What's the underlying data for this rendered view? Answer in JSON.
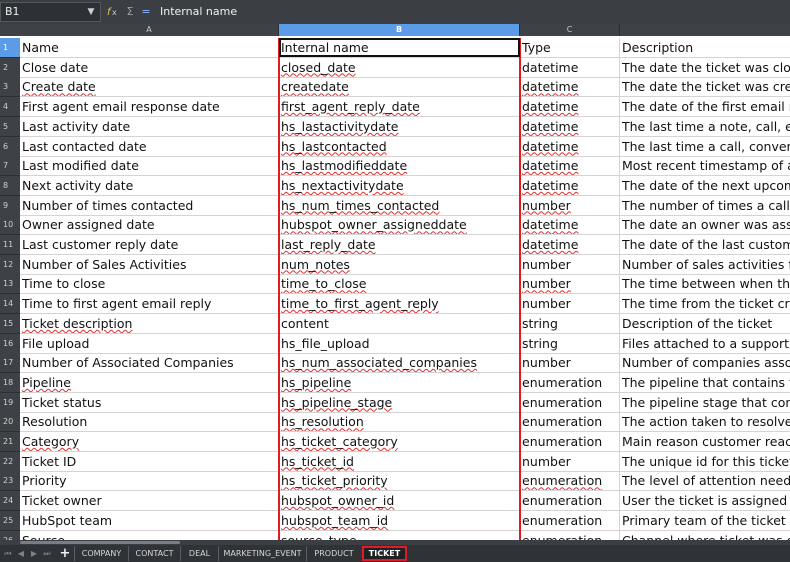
{
  "formula_bar": {
    "cell_ref": "B1",
    "content": "Internal name",
    "icons": [
      "function-wizard-icon",
      "sum-icon",
      "equals-icon"
    ]
  },
  "columns": [
    "A",
    "B",
    "C"
  ],
  "selected_column": "B",
  "rows": [
    {
      "n": "1",
      "name": "Name",
      "internal": "Internal name",
      "type": "Type",
      "desc": "Description"
    },
    {
      "n": "2",
      "name": "Close date",
      "internal": "closed_date",
      "type": "datetime",
      "desc": "The date the ticket was closed"
    },
    {
      "n": "3",
      "name": "Create date",
      "internal": "createdate",
      "type": "datetime",
      "desc": "The date the ticket was created"
    },
    {
      "n": "4",
      "name": "First agent email response date",
      "internal": "first_agent_reply_date",
      "type": "datetime",
      "desc": "The date of the first email res"
    },
    {
      "n": "5",
      "name": "Last activity date",
      "internal": "hs_lastactivitydate",
      "type": "datetime",
      "desc": "The last time a note, call, em"
    },
    {
      "n": "6",
      "name": "Last contacted date",
      "internal": "hs_lastcontacted",
      "type": "datetime",
      "desc": "The last time a call, conversa"
    },
    {
      "n": "7",
      "name": "Last modified date",
      "internal": "hs_lastmodifieddate",
      "type": "datetime",
      "desc": "Most recent timestamp of an"
    },
    {
      "n": "8",
      "name": "Next activity date",
      "internal": "hs_nextactivitydate",
      "type": "datetime",
      "desc": "The date of the next upcomin"
    },
    {
      "n": "9",
      "name": "Number of times contacted",
      "internal": "hs_num_times_contacted",
      "type": "number",
      "desc": "The number of times a call, e"
    },
    {
      "n": "10",
      "name": "Owner assigned date",
      "internal": "hubspot_owner_assigneddate",
      "type": "datetime",
      "desc": "The date an owner was assig"
    },
    {
      "n": "11",
      "name": "Last customer reply date",
      "internal": "last_reply_date",
      "type": "datetime",
      "desc": "The date of the last customer"
    },
    {
      "n": "12",
      "name": "Number of Sales Activities",
      "internal": "num_notes",
      "type": "number",
      "desc": "Number of sales activities for"
    },
    {
      "n": "13",
      "name": "Time to close",
      "internal": "time_to_close",
      "type": "number",
      "desc": "The time between when the t"
    },
    {
      "n": "14",
      "name": "Time to first agent email reply",
      "internal": "time_to_first_agent_reply",
      "type": "number",
      "desc": "The time from the ticket crea"
    },
    {
      "n": "15",
      "name": "Ticket description",
      "internal": "content",
      "type": "string",
      "desc": "Description of the ticket"
    },
    {
      "n": "16",
      "name": "File upload",
      "internal": "hs_file_upload",
      "type": "string",
      "desc": "Files attached to a support fo"
    },
    {
      "n": "17",
      "name": "Number of Associated Companies",
      "internal": "hs_num_associated_companies",
      "type": "number",
      "desc": "Number of companies associ"
    },
    {
      "n": "18",
      "name": "Pipeline",
      "internal": "hs_pipeline",
      "type": "enumeration",
      "desc": "The pipeline that contains thi"
    },
    {
      "n": "19",
      "name": "Ticket status",
      "internal": "hs_pipeline_stage",
      "type": "enumeration",
      "desc": "The pipeline stage that conta"
    },
    {
      "n": "20",
      "name": "Resolution",
      "internal": "hs_resolution",
      "type": "enumeration",
      "desc": "The action taken to resolve th"
    },
    {
      "n": "21",
      "name": "Category",
      "internal": "hs_ticket_category",
      "type": "enumeration",
      "desc": "Main reason customer reache"
    },
    {
      "n": "22",
      "name": "Ticket ID",
      "internal": "hs_ticket_id",
      "type": "number",
      "desc": "The unique id for this ticket. T"
    },
    {
      "n": "23",
      "name": "Priority",
      "internal": "hs_ticket_priority",
      "type": "enumeration",
      "desc": "The level of attention needed"
    },
    {
      "n": "24",
      "name": "Ticket owner",
      "internal": "hubspot_owner_id",
      "type": "enumeration",
      "desc": "User the ticket is assigned to"
    },
    {
      "n": "25",
      "name": "HubSpot team",
      "internal": "hubspot_team_id",
      "type": "enumeration",
      "desc": "Primary team of the ticket ow"
    },
    {
      "n": "26",
      "name": "Source",
      "internal": "source_type",
      "type": "enumeration",
      "desc": "Channel where ticket was ori"
    }
  ],
  "sheet_tabs": [
    "COMPANY",
    "CONTACT",
    "DEAL",
    "MARKETING_EVENT",
    "PRODUCT",
    "TICKET"
  ],
  "active_tab": "TICKET",
  "colors": {
    "highlight": "#e01b24",
    "column_selected": "#5c9ce6"
  }
}
